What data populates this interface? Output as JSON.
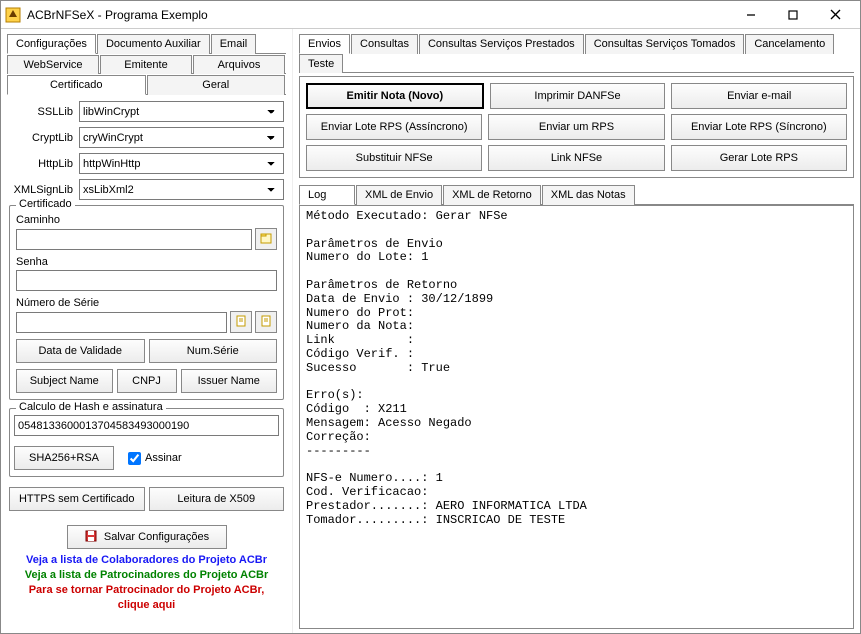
{
  "window": {
    "title": "ACBrNFSeX - Programa Exemplo"
  },
  "left": {
    "mainTabs": [
      "Configurações",
      "Documento Auxiliar",
      "Email"
    ],
    "subTabs1": [
      "WebService",
      "Emitente",
      "Arquivos"
    ],
    "subTabs2": [
      "Certificado",
      "Geral"
    ],
    "ssllibLabel": "SSLLib",
    "ssllib": "libWinCrypt",
    "cryptlibLabel": "CryptLib",
    "cryptlib": "cryWinCrypt",
    "httplibLabel": "HttpLib",
    "httplib": "httpWinHttp",
    "xmlsignlibLabel": "XMLSignLib",
    "xmlsignlib": "xsLibXml2",
    "cert": {
      "group": "Certificado",
      "caminhoLabel": "Caminho",
      "caminho": "",
      "senhaLabel": "Senha",
      "senha": "",
      "numSerieLabel": "Número de Série",
      "numSerie": "",
      "btnDataValidade": "Data de Validade",
      "btnNumSerie": "Num.Série",
      "btnSubjectName": "Subject Name",
      "btnCNPJ": "CNPJ",
      "btnIssuerName": "Issuer Name"
    },
    "hash": {
      "group": "Calculo de Hash e assinatura",
      "value": "0548133600013704583493000190",
      "btnSha": "SHA256+RSA",
      "assinarLabel": "Assinar"
    },
    "btnHttpsSemCert": "HTTPS sem Certificado",
    "btnLeituraX509": "Leitura de X509",
    "btnSalvar": "Salvar Configurações",
    "linkColab": "Veja a lista de Colaboradores do Projeto ACBr",
    "linkPatr": "Veja a lista de Patrocinadores do Projeto ACBr",
    "linkPatr2a": "Para se tornar Patrocinador do Projeto ACBr,",
    "linkPatr2b": "clique aqui"
  },
  "right": {
    "mainTabs": [
      "Envios",
      "Consultas",
      "Consultas Serviços Prestados",
      "Consultas Serviços Tomados",
      "Cancelamento",
      "Teste"
    ],
    "actions": {
      "emitirNota": "Emitir Nota (Novo)",
      "imprimirDANFSe": "Imprimir DANFSe",
      "enviarEmail": "Enviar e-mail",
      "enviarLoteAssinc": "Enviar Lote RPS (Assíncrono)",
      "enviarUmRPS": "Enviar um RPS",
      "enviarLoteSinc": "Enviar Lote RPS (Síncrono)",
      "substituirNFSe": "Substituir NFSe",
      "linkNFSe": "Link NFSe",
      "gerarLoteRPS": "Gerar Lote RPS"
    },
    "logTabs": [
      "Log",
      "XML de Envio",
      "XML de Retorno",
      "XML das Notas"
    ],
    "logContent": "Método Executado: Gerar NFSe\n\nParâmetros de Envio\nNumero do Lote: 1\n\nParâmetros de Retorno\nData de Envio : 30/12/1899\nNumero do Prot:\nNumero da Nota:\nLink          :\nCódigo Verif. :\nSucesso       : True\n\nErro(s):\nCódigo  : X211\nMensagem: Acesso Negado\nCorreção:\n---------\n\nNFS-e Numero....: 1\nCod. Verificacao:\nPrestador.......: AERO INFORMATICA LTDA\nTomador.........: INSCRICAO DE TESTE"
  }
}
